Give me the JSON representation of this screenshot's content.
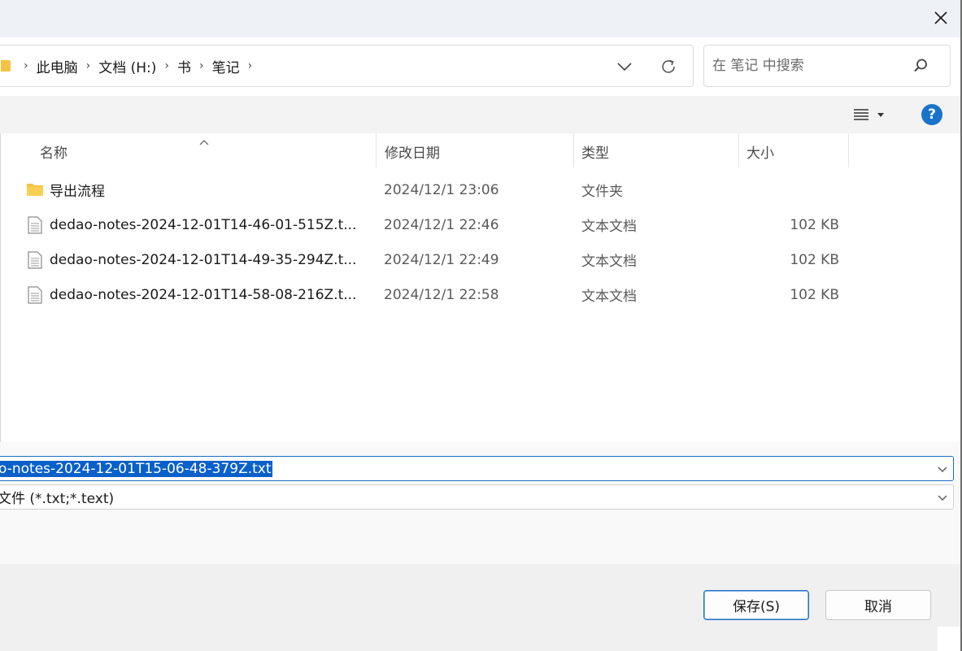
{
  "window": {
    "close_glyph": "✕"
  },
  "address": {
    "crumbs": [
      "此电脑",
      "文档 (H:)",
      "书",
      "笔记"
    ],
    "separator": "›",
    "search_placeholder": "在 笔记 中搜索"
  },
  "toolbar": {
    "help_label": "?"
  },
  "columns": {
    "name": "名称",
    "date": "修改日期",
    "type": "类型",
    "size": "大小"
  },
  "files": [
    {
      "name": "导出流程",
      "date": "2024/12/1 23:06",
      "type": "文件夹",
      "size": "",
      "icon": "folder-icon"
    },
    {
      "name": "dedao-notes-2024-12-01T14-46-01-515Z.t...",
      "date": "2024/12/1 22:46",
      "type": "文本文档",
      "size": "102 KB",
      "icon": "text-file-icon"
    },
    {
      "name": "dedao-notes-2024-12-01T14-49-35-294Z.t...",
      "date": "2024/12/1 22:49",
      "type": "文本文档",
      "size": "102 KB",
      "icon": "text-file-icon"
    },
    {
      "name": "dedao-notes-2024-12-01T14-58-08-216Z.t...",
      "date": "2024/12/1 22:58",
      "type": "文本文档",
      "size": "102 KB",
      "icon": "text-file-icon"
    }
  ],
  "save_fields": {
    "filename_value": "o-notes-2024-12-01T15-06-48-379Z.txt",
    "filetype_value": "文件 (*.txt;*.text)"
  },
  "buttons": {
    "save": "保存(S)",
    "cancel": "取消"
  },
  "colors": {
    "accent": "#0a60c9",
    "folder": "#f5c343",
    "help": "#1a73c9"
  }
}
